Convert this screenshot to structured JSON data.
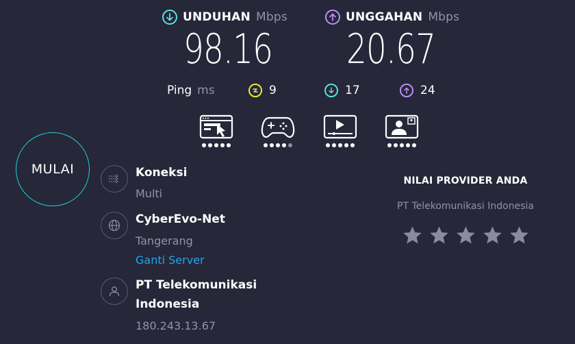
{
  "download": {
    "label": "UNDUHAN",
    "unit": "Mbps",
    "value": "98.16",
    "color": "#5ce0df"
  },
  "upload": {
    "label": "UNGGAHAN",
    "unit": "Mbps",
    "value": "20.67",
    "color": "#bd8ef7"
  },
  "ping": {
    "label": "Ping",
    "unit": "ms",
    "idle": {
      "value": "9",
      "icon": "lightning-icon",
      "color": "#f2e34a"
    },
    "download": {
      "value": "17",
      "icon": "arrow-down-icon",
      "color": "#5ce0df"
    },
    "upload": {
      "value": "24",
      "icon": "arrow-up-icon",
      "color": "#bd8ef7"
    }
  },
  "activities": [
    {
      "name": "web-browsing-icon",
      "rating": 5
    },
    {
      "name": "gaming-icon",
      "rating": 4
    },
    {
      "name": "video-streaming-icon",
      "rating": 5
    },
    {
      "name": "video-call-icon",
      "rating": 5
    }
  ],
  "start_button": {
    "label": "MULAI",
    "color": "#1fd3df"
  },
  "connection": {
    "title": "Koneksi",
    "value": "Multi"
  },
  "server": {
    "name": "CyberEvo-Net",
    "location": "Tangerang",
    "change_label": "Ganti Server"
  },
  "provider": {
    "name_line1": "PT Telekomunikasi",
    "name_line2": "Indonesia",
    "ip": "180.243.13.67"
  },
  "rating": {
    "title": "NILAI PROVIDER ANDA",
    "provider_name": "PT Telekomunikasi Indonesia",
    "stars": 5,
    "star_color": "#8a8c9e"
  }
}
